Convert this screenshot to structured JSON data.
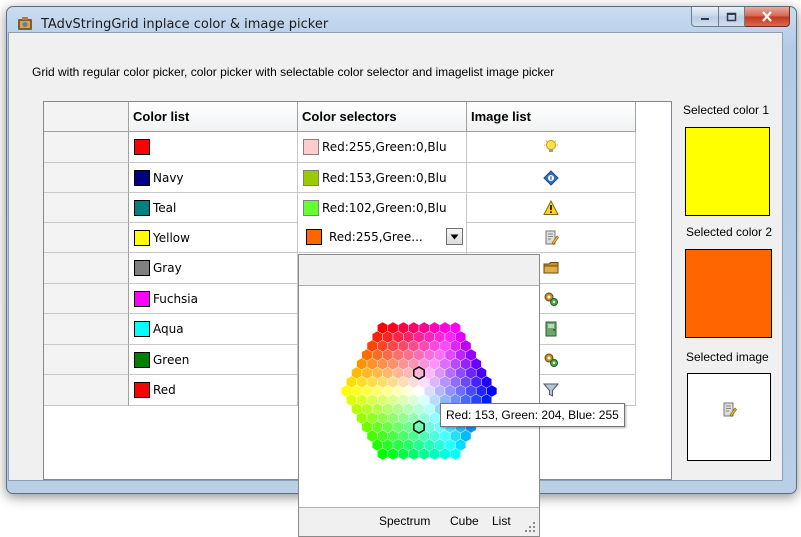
{
  "window": {
    "title": "TAdvStringGrid inplace color & image picker"
  },
  "description": "Grid with regular color picker, color picker with selectable color selector and imagelist image picker",
  "grid": {
    "headers": [
      "Color list",
      "Color selectors",
      "Image list"
    ],
    "rows": [
      {
        "color_name": "",
        "color": "#ff0000",
        "selector_text": "Red:255,Green:0,Blu",
        "selector_color": "#ffcccc",
        "image_icon": "lightbulb-icon"
      },
      {
        "color_name": "Navy",
        "color": "#000080",
        "selector_text": "Red:153,Green:0,Blu",
        "selector_color": "#99cc00",
        "image_icon": "info-diamond-icon"
      },
      {
        "color_name": "Teal",
        "color": "#008080",
        "selector_text": "Red:102,Green:0,Blu",
        "selector_color": "#66ff33",
        "image_icon": "warning-icon"
      },
      {
        "color_name": "Yellow",
        "color": "#ffff00",
        "selector_text": "Red:255,Gree...",
        "selector_color": "#ff6600",
        "image_icon": "edit-document-icon"
      },
      {
        "color_name": "Gray",
        "color": "#808080",
        "selector_text": "",
        "selector_color": "",
        "image_icon": "folder-icon"
      },
      {
        "color_name": "Fuchsia",
        "color": "#ff00ff",
        "selector_text": "",
        "selector_color": "",
        "image_icon": "gears-icon"
      },
      {
        "color_name": "Aqua",
        "color": "#00ffff",
        "selector_text": "",
        "selector_color": "",
        "image_icon": "door-icon"
      },
      {
        "color_name": "Green",
        "color": "#008000",
        "selector_text": "",
        "selector_color": "",
        "image_icon": "gears-icon"
      },
      {
        "color_name": "Red",
        "color": "#ff0000",
        "selector_text": "",
        "selector_color": "",
        "image_icon": "filter-icon"
      }
    ]
  },
  "panel": {
    "selected_color_1_label": "Selected color 1",
    "selected_color_1": "#ffff00",
    "selected_color_2_label": "Selected color 2",
    "selected_color_2": "#ff6600",
    "selected_image_label": "Selected image",
    "selected_image_icon": "edit-document-icon"
  },
  "picker": {
    "tooltip": "Red: 153,  Green: 204,  Blue: 255",
    "modes": [
      "Spectrum",
      "Cube",
      "List"
    ]
  }
}
